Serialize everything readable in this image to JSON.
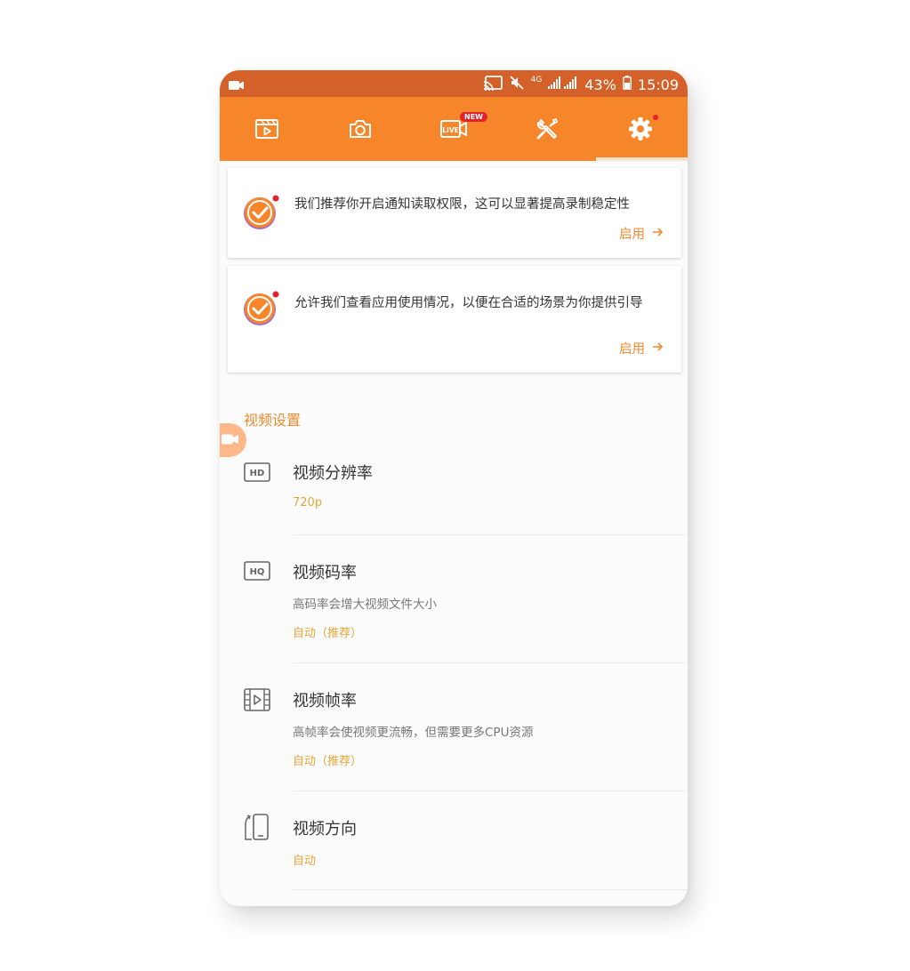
{
  "status_bar": {
    "battery": "43%",
    "time": "15:09",
    "network": "4G"
  },
  "tabs": [
    {
      "name": "videos-tab",
      "icon": "video-list-icon"
    },
    {
      "name": "screenshot-tab",
      "icon": "camera-icon"
    },
    {
      "name": "live-tab",
      "icon": "live-icon",
      "label": "LIVE",
      "badge": "NEW"
    },
    {
      "name": "tools-tab",
      "icon": "tools-icon"
    },
    {
      "name": "settings-tab",
      "icon": "gear-icon",
      "selected": true
    }
  ],
  "cards": [
    {
      "text": "我们推荐你开启通知读取权限，这可以显著提高录制稳定性",
      "action": "启用"
    },
    {
      "text": "允许我们查看应用使用情况，以便在合适的场景为你提供引导",
      "action": "启用"
    }
  ],
  "section": {
    "title": "视频设置"
  },
  "settings": [
    {
      "icon": "hd-icon",
      "icon_label": "HD",
      "title": "视频分辨率",
      "desc": "",
      "value": "720p"
    },
    {
      "icon": "hq-icon",
      "icon_label": "HQ",
      "title": "视频码率",
      "desc": "高码率会增大视频文件大小",
      "value": "自动（推荐）"
    },
    {
      "icon": "film-frame-icon",
      "title": "视频帧率",
      "desc": "高帧率会使视频更流畅，但需要更多CPU资源",
      "value": "自动（推荐）"
    },
    {
      "icon": "phone-rotate-icon",
      "title": "视频方向",
      "desc": "",
      "value": "自动"
    }
  ],
  "colors": {
    "status_bar": "#d5612a",
    "tab_bar": "#f7852a",
    "accent": "#f08a2e",
    "value": "#e5a63a",
    "badge": "#e2232c"
  }
}
